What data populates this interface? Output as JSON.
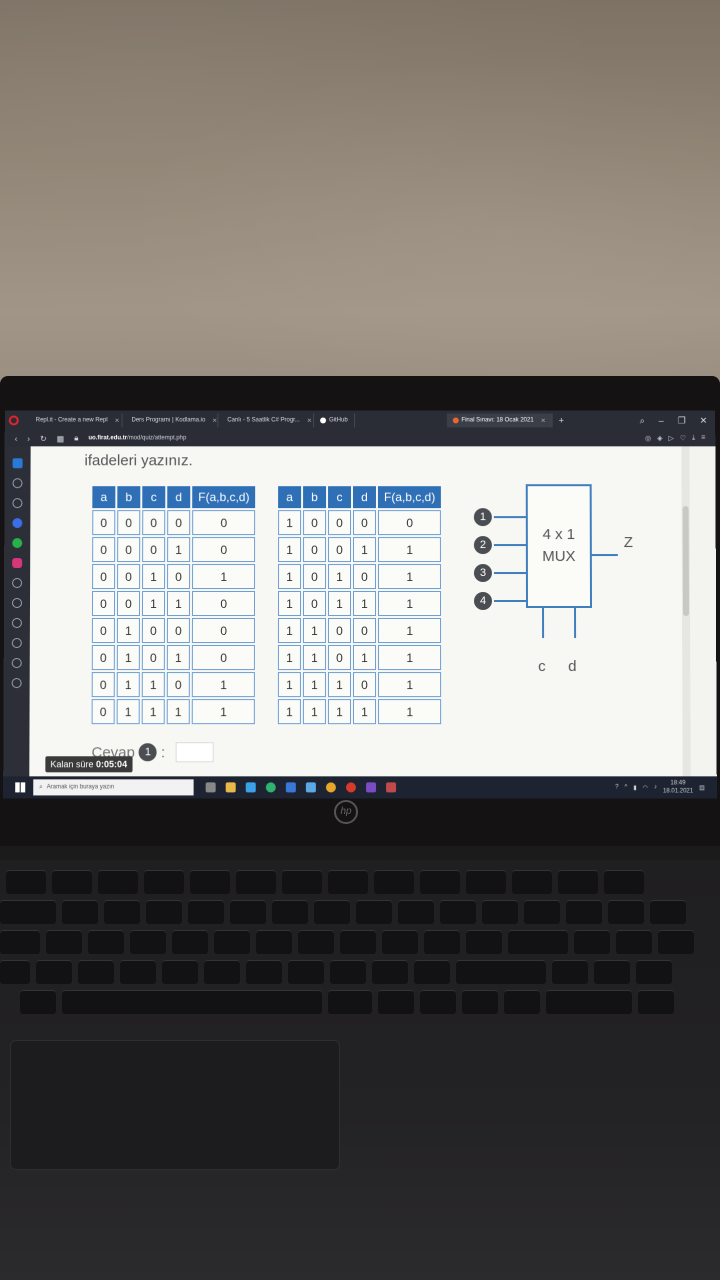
{
  "browser": {
    "tabs": [
      {
        "label": "Repl.it - Create a new Repl"
      },
      {
        "label": "Ders Programı | Kodlama.io"
      },
      {
        "label": "Canlı - 5 Saatlik C# Progr..."
      },
      {
        "label": "GitHub"
      },
      {
        "label": "Final Sınavı: 18 Ocak 2021"
      }
    ],
    "url_domain": "uo.firat.edu.tr",
    "url_path": "/mod/quiz/attempt.php"
  },
  "question": {
    "text": "ifadeleri yazınız."
  },
  "truth_table_left": {
    "headers": [
      "a",
      "b",
      "c",
      "d",
      "F(a,b,c,d)"
    ],
    "rows": [
      [
        "0",
        "0",
        "0",
        "0",
        "0"
      ],
      [
        "0",
        "0",
        "0",
        "1",
        "0"
      ],
      [
        "0",
        "0",
        "1",
        "0",
        "1"
      ],
      [
        "0",
        "0",
        "1",
        "1",
        "0"
      ],
      [
        "0",
        "1",
        "0",
        "0",
        "0"
      ],
      [
        "0",
        "1",
        "0",
        "1",
        "0"
      ],
      [
        "0",
        "1",
        "1",
        "0",
        "1"
      ],
      [
        "0",
        "1",
        "1",
        "1",
        "1"
      ]
    ]
  },
  "truth_table_right": {
    "headers": [
      "a",
      "b",
      "c",
      "d",
      "F(a,b,c,d)"
    ],
    "rows": [
      [
        "1",
        "0",
        "0",
        "0",
        "0"
      ],
      [
        "1",
        "0",
        "0",
        "1",
        "1"
      ],
      [
        "1",
        "0",
        "1",
        "0",
        "1"
      ],
      [
        "1",
        "0",
        "1",
        "1",
        "1"
      ],
      [
        "1",
        "1",
        "0",
        "0",
        "1"
      ],
      [
        "1",
        "1",
        "0",
        "1",
        "1"
      ],
      [
        "1",
        "1",
        "1",
        "0",
        "1"
      ],
      [
        "1",
        "1",
        "1",
        "1",
        "1"
      ]
    ]
  },
  "mux": {
    "size": "4 x 1",
    "name": "MUX",
    "inputs": [
      "1",
      "2",
      "3",
      "4"
    ],
    "output": "Z",
    "selects": [
      "c",
      "d"
    ]
  },
  "answer": {
    "label": "Cevap",
    "number": "1",
    "colon": ":"
  },
  "timer": {
    "label": "Kalan süre",
    "value": "0:05:04"
  },
  "taskbar": {
    "search_placeholder": "Aramak için buraya yazın",
    "time": "18:49",
    "date": "18.01.2021"
  },
  "colors": {
    "table_header": "#2f6fb6",
    "table_border": "#6ea0d6",
    "mux_border": "#3f7fbd"
  }
}
